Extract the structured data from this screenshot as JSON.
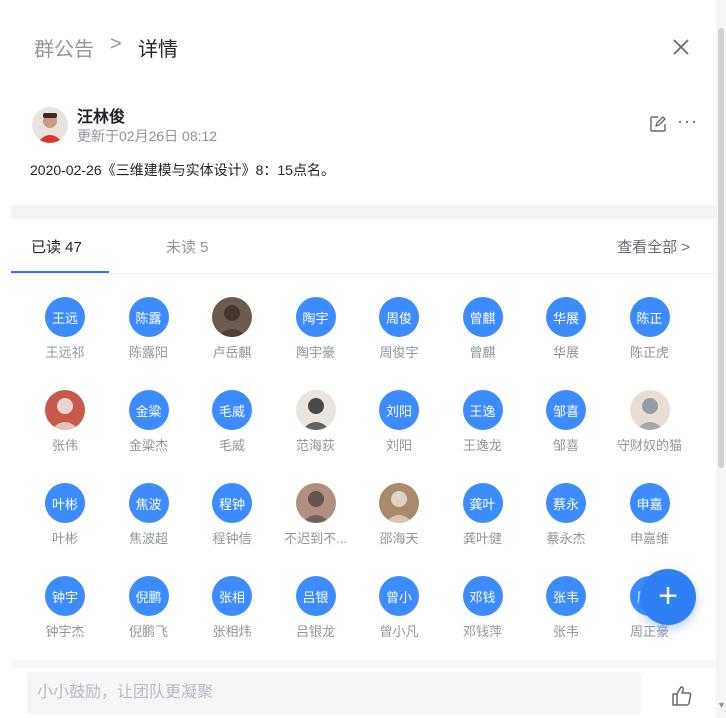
{
  "header": {
    "breadcrumb_parent": "群公告",
    "breadcrumb_sep": ">",
    "breadcrumb_current": "详情"
  },
  "author": {
    "name": "汪林俊",
    "updated": "更新于02月26日 08:12"
  },
  "announcement": {
    "text": "2020-02-26《三维建模与实体设计》8：15点名。"
  },
  "tabs": {
    "read": "已读 47",
    "unread": "未读 5",
    "view_all": "查看全部 >"
  },
  "members": [
    {
      "badge": "王远",
      "name": "王远祁",
      "photo": false
    },
    {
      "badge": "陈露",
      "name": "陈露阳",
      "photo": false
    },
    {
      "badge": "",
      "name": "卢岳麒",
      "photo": true
    },
    {
      "badge": "陶宇",
      "name": "陶宇豪",
      "photo": false
    },
    {
      "badge": "周俊",
      "name": "周俊宇",
      "photo": false
    },
    {
      "badge": "曾麒",
      "name": "曾麒",
      "photo": false
    },
    {
      "badge": "华展",
      "name": "华展",
      "photo": false
    },
    {
      "badge": "陈正",
      "name": "陈正虎",
      "photo": false
    },
    {
      "badge": "",
      "name": "张伟",
      "photo": true
    },
    {
      "badge": "金粱",
      "name": "金粱杰",
      "photo": false
    },
    {
      "badge": "毛威",
      "name": "毛威",
      "photo": false
    },
    {
      "badge": "",
      "name": "范海荻",
      "photo": true
    },
    {
      "badge": "刘阳",
      "name": "刘阳",
      "photo": false
    },
    {
      "badge": "王逸",
      "name": "王逸龙",
      "photo": false
    },
    {
      "badge": "邹喜",
      "name": "邹喜",
      "photo": false
    },
    {
      "badge": "",
      "name": "守财奴的猫",
      "photo": true
    },
    {
      "badge": "叶彬",
      "name": "叶彬",
      "photo": false
    },
    {
      "badge": "焦波",
      "name": "焦波超",
      "photo": false
    },
    {
      "badge": "程钟",
      "name": "程钟信",
      "photo": false
    },
    {
      "badge": "",
      "name": "不迟到不...",
      "photo": true
    },
    {
      "badge": "",
      "name": "邵海天",
      "photo": true
    },
    {
      "badge": "龚叶",
      "name": "龚叶健",
      "photo": false
    },
    {
      "badge": "蔡永",
      "name": "蔡永杰",
      "photo": false
    },
    {
      "badge": "申嘉",
      "name": "申嘉维",
      "photo": false
    },
    {
      "badge": "钟宇",
      "name": "钟宇杰",
      "photo": false
    },
    {
      "badge": "倪鹏",
      "name": "倪鹏飞",
      "photo": false
    },
    {
      "badge": "张相",
      "name": "张相炜",
      "photo": false
    },
    {
      "badge": "吕银",
      "name": "吕银龙",
      "photo": false
    },
    {
      "badge": "曾小",
      "name": "曾小凡",
      "photo": false
    },
    {
      "badge": "邓钱",
      "name": "邓钱萍",
      "photo": false
    },
    {
      "badge": "张韦",
      "name": "张韦",
      "photo": false
    },
    {
      "badge": "周正",
      "name": "周正豪",
      "photo": false
    }
  ],
  "fab": {
    "label": "+"
  },
  "comment": {
    "placeholder": "小小鼓励，让团队更凝聚"
  },
  "colors": {
    "accent": "#3370ff",
    "badge": "#3c8cff",
    "fab": "#2f80f5"
  },
  "icons": [
    "close-icon",
    "edit-icon",
    "more-icon",
    "thumbs-up-icon",
    "plus-icon"
  ]
}
